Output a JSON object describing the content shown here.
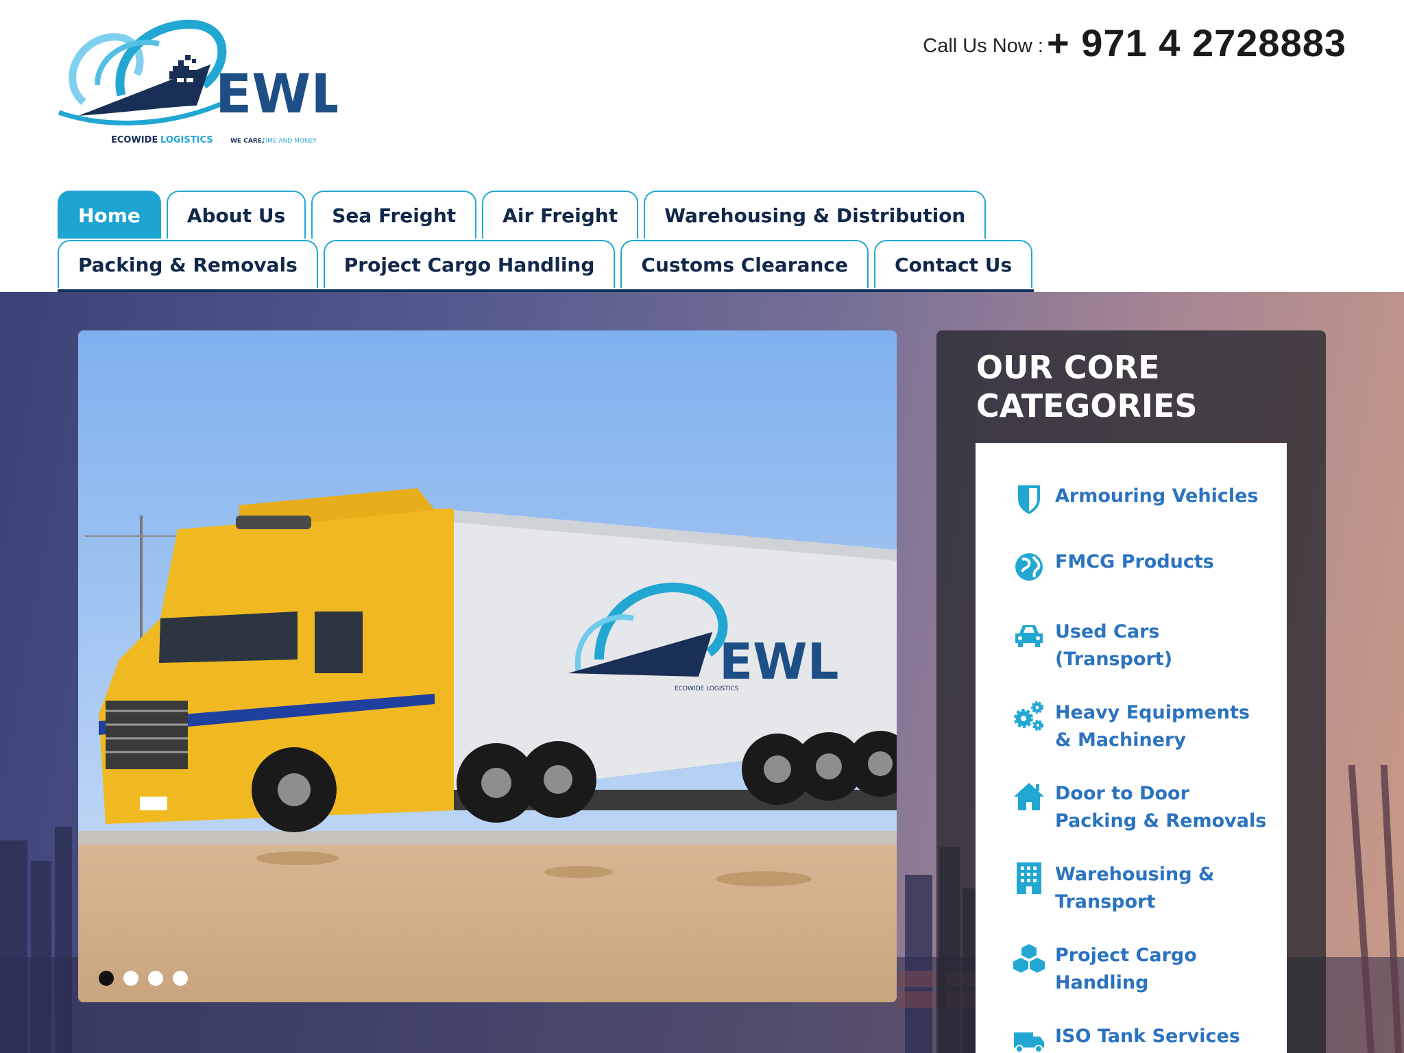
{
  "brand": {
    "logo_text": "EWL",
    "logo_company": "ECOWIDE",
    "logo_company_accent": "LOGISTICS",
    "logo_tagline": "WE CARE,",
    "logo_tagline_accent": "TIME AND MONEY"
  },
  "header": {
    "call_label": "Call Us Now :",
    "phone": "+ 971 4 2728883"
  },
  "nav": {
    "row1": [
      {
        "label": "Home",
        "active": true
      },
      {
        "label": "About Us"
      },
      {
        "label": "Sea Freight"
      },
      {
        "label": "Air Freight"
      },
      {
        "label": "Warehousing & Distribution"
      }
    ],
    "row2": [
      {
        "label": "Packing & Removals"
      },
      {
        "label": "Project Cargo Handling"
      },
      {
        "label": "Customs Clearance"
      },
      {
        "label": "Contact Us"
      }
    ]
  },
  "slider": {
    "trailer_logo_text": "EWL",
    "trailer_logo_sub": "ECOWIDE LOGISTICS",
    "slide_count": 4,
    "active_slide": 1
  },
  "categories": {
    "title_line1": "OUR CORE",
    "title_line2": "CATEGORIES",
    "items": [
      {
        "icon": "shield-icon",
        "line1": "Armouring Vehicles"
      },
      {
        "icon": "globe-icon",
        "line1": "FMCG Products"
      },
      {
        "icon": "car-icon",
        "line1": "Used Cars",
        "line2": "(Transport)"
      },
      {
        "icon": "gears-icon",
        "line1": "Heavy Equipments",
        "line2": "& Machinery"
      },
      {
        "icon": "home-icon",
        "line1": "Door to Door",
        "line2": "Packing & Removals"
      },
      {
        "icon": "building-icon",
        "line1": "Warehousing &",
        "line2": "Transport"
      },
      {
        "icon": "cubes-icon",
        "line1": "Project Cargo",
        "line2": "Handling"
      },
      {
        "icon": "truck-icon",
        "line1": "ISO Tank Services"
      }
    ]
  },
  "colors": {
    "accent": "#1da4d3",
    "nav_text": "#12284a",
    "category_text": "#2b73c0",
    "phone_text": "#1b1b1b"
  }
}
